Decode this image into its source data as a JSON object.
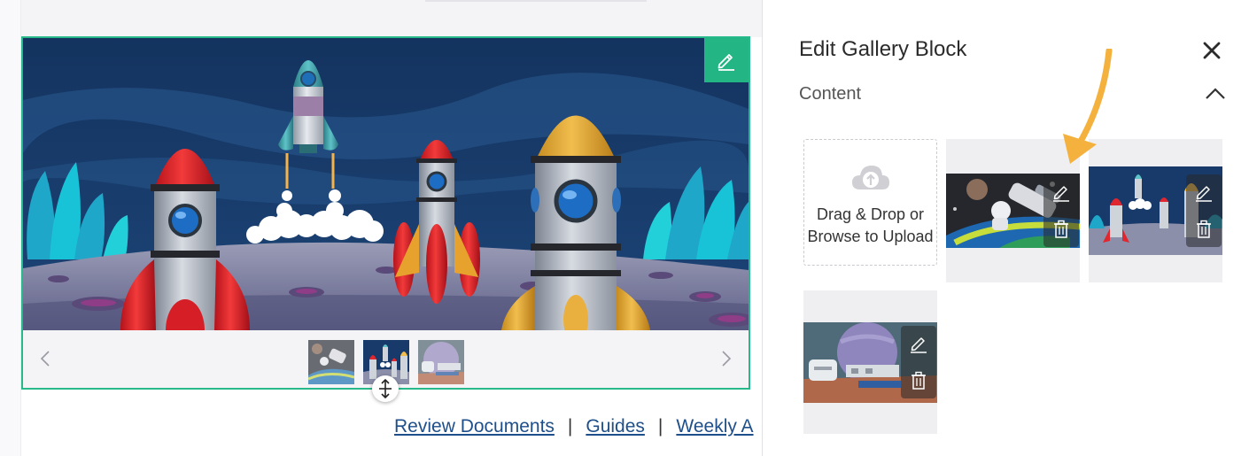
{
  "canvas": {
    "gallery": {
      "edit_icon": "pencil-icon",
      "prev_icon": "chevron-left-icon",
      "next_icon": "chevron-right-icon",
      "resize_icon": "vertical-resize-icon",
      "active_thumbnail": 2,
      "accent_color": "#23b684"
    },
    "footer_links": {
      "review_documents": "Review Documents",
      "separator": "|",
      "guides": "Guides",
      "weekly": "Weekly A"
    }
  },
  "panel": {
    "title": "Edit Gallery Block",
    "close_icon": "close-icon",
    "section": {
      "label": "Content",
      "chevron_icon": "chevron-up-icon"
    },
    "uploader": {
      "icon": "cloud-upload-icon",
      "line1": "Drag & Drop or",
      "line2": "Browse to Upload"
    },
    "items": [
      {
        "name": "astronaut-space-image",
        "edit_icon": "pencil-icon",
        "delete_icon": "trash-icon"
      },
      {
        "name": "rocket-launch-image",
        "edit_icon": "pencil-icon",
        "delete_icon": "trash-icon"
      },
      {
        "name": "space-station-planet-image",
        "edit_icon": "pencil-icon",
        "delete_icon": "trash-icon"
      }
    ],
    "callout_color": "#f4b13e"
  }
}
